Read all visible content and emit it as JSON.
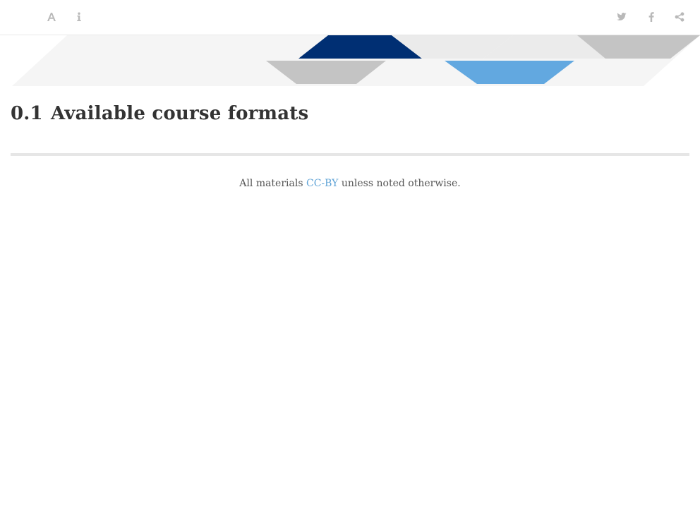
{
  "toolbar": {
    "left_icons": [
      "font-settings-icon",
      "info-icon"
    ],
    "right_icons": [
      "twitter-icon",
      "facebook-icon",
      "share-icon"
    ],
    "icon_color": "#b9b9b9"
  },
  "banner": {
    "colors": {
      "navy": "#002f73",
      "blue": "#62a8e0",
      "gray": "#c4c4c4",
      "light": "#ebebeb",
      "faint": "#f5f5f5"
    }
  },
  "section": {
    "number": "0.1",
    "title": "Available course formats"
  },
  "footer": {
    "prefix": "All materials ",
    "license_link": "CC-BY",
    "suffix": " unless noted otherwise."
  }
}
